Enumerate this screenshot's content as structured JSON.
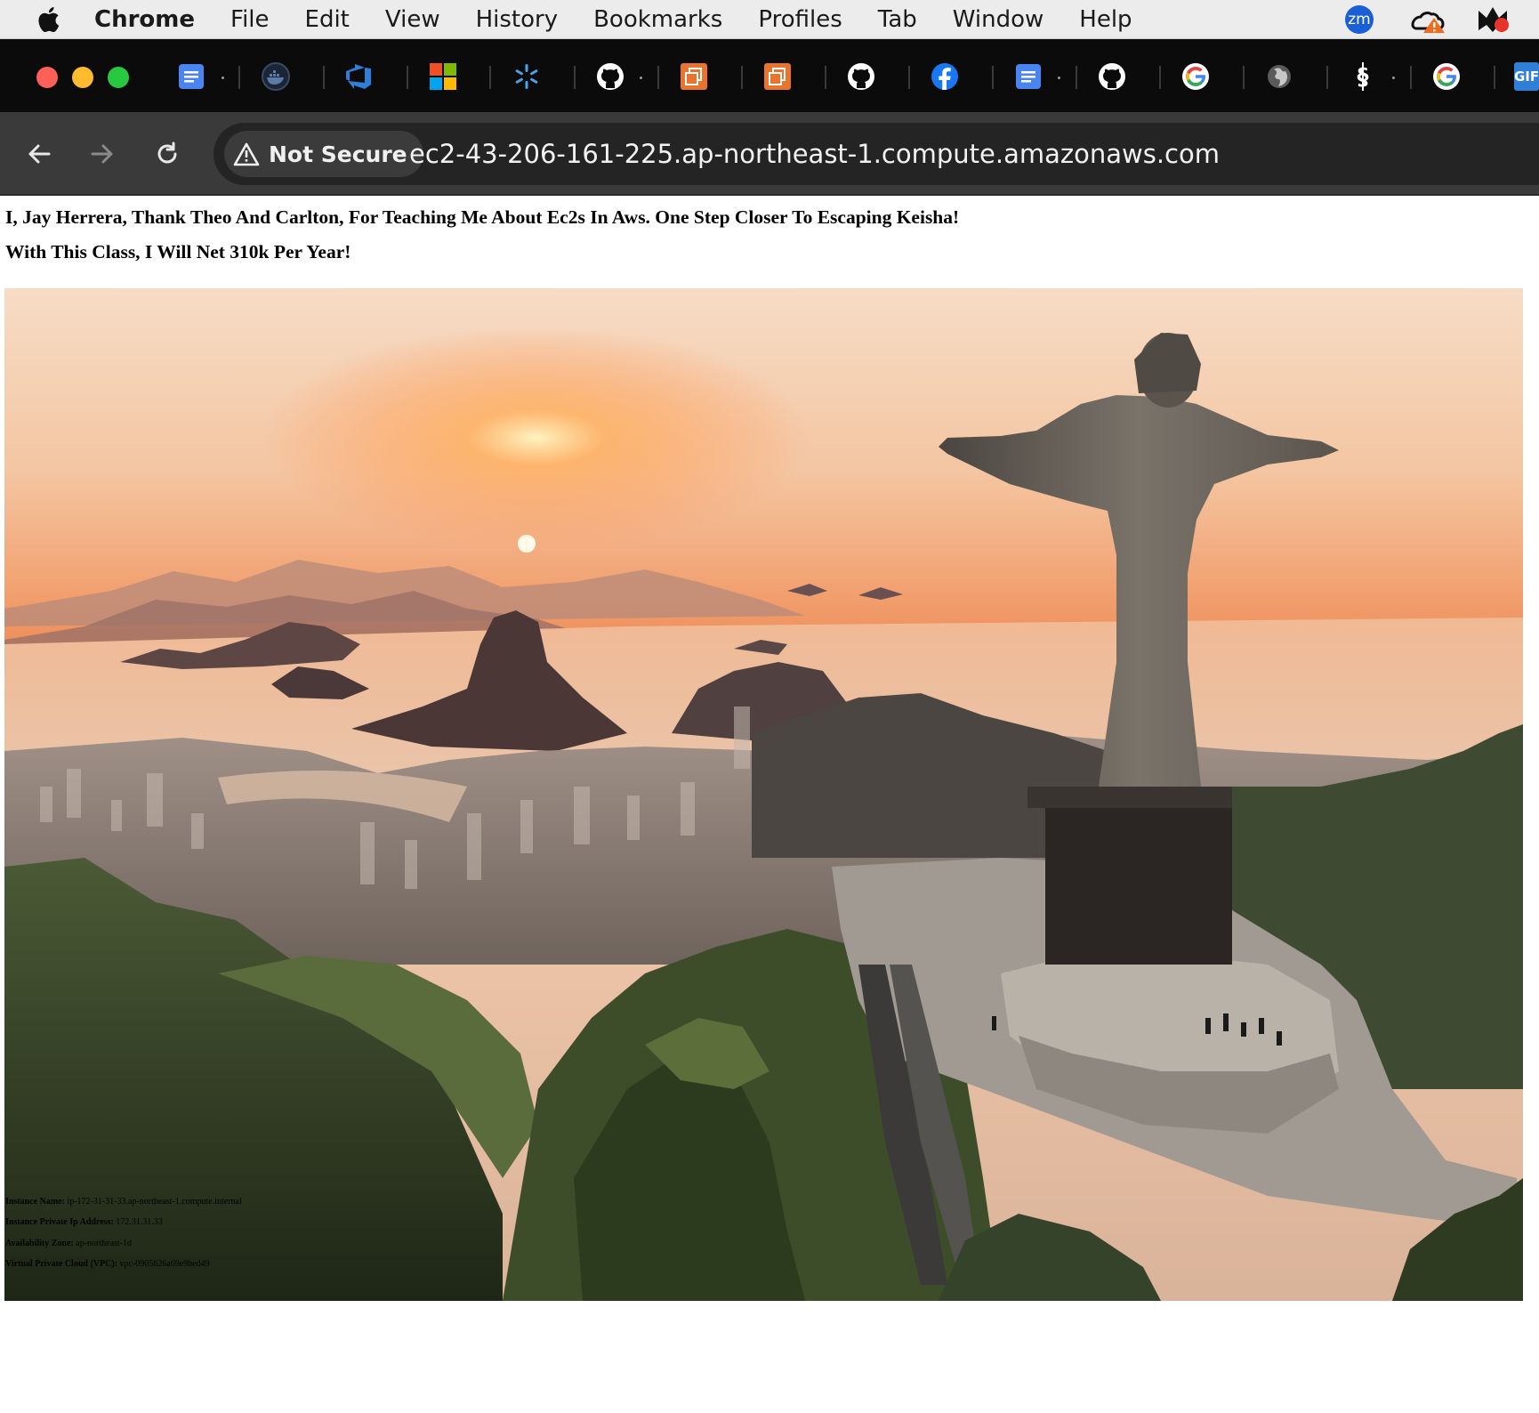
{
  "menubar": {
    "app_name": "Chrome",
    "items": [
      "File",
      "Edit",
      "View",
      "History",
      "Bookmarks",
      "Profiles",
      "Tab",
      "Window",
      "Help"
    ],
    "zoom_label": "zm"
  },
  "tabs": [
    {
      "icon": "google-docs-icon"
    },
    {
      "icon": "docker-icon"
    },
    {
      "icon": "azure-devops-icon"
    },
    {
      "icon": "microsoft-icon"
    },
    {
      "icon": "walmart-spark-icon"
    },
    {
      "icon": "github-icon"
    },
    {
      "icon": "aws-icon"
    },
    {
      "icon": "aws-icon"
    },
    {
      "icon": "github-icon"
    },
    {
      "icon": "facebook-icon"
    },
    {
      "icon": "google-docs-icon"
    },
    {
      "icon": "github-icon"
    },
    {
      "icon": "google-icon"
    },
    {
      "icon": "globe-icon"
    },
    {
      "icon": "section-sign-icon"
    },
    {
      "icon": "google-icon"
    },
    {
      "icon": "gif-icon",
      "label": "GIF"
    }
  ],
  "toolbar": {
    "security_label": "Not Secure",
    "url": "ec2-43-206-161-225.ap-northeast-1.compute.amazonaws.com"
  },
  "page": {
    "heading_1": "I, Jay Herrera, Thank Theo And Carlton, For Teaching Me About Ec2s In Aws. One Step Closer To Escaping Keisha!",
    "heading_2": "With This Class, I Will Net 310k Per Year!",
    "instance_info": [
      {
        "label": "Instance Name:",
        "value": "ip-172-31-31-33.ap-northeast-1.compute.internal"
      },
      {
        "label": "Instance Private Ip Address:",
        "value": "172.31.31.33"
      },
      {
        "label": "Availability Zone:",
        "value": "ap-northeast-1d"
      },
      {
        "label": "Virtual Private Cloud (VPC):",
        "value": "vpc-0905626a69e9bed49"
      }
    ]
  },
  "colors": {
    "tab_strip": "#0b0b0b",
    "toolbar": "#3a3a3a",
    "omnibox": "#242424",
    "close": "#fe5f57",
    "minimize": "#febc2e",
    "zoom": "#28c840"
  }
}
